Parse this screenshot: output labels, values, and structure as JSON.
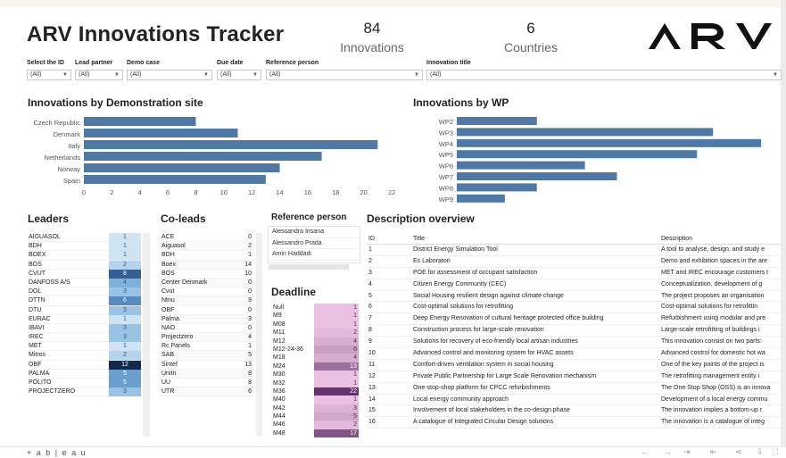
{
  "header": {
    "title": "ARV Innovations Tracker",
    "kpis": [
      {
        "value": "84",
        "label": "Innovations"
      },
      {
        "value": "6",
        "label": "Countries"
      }
    ],
    "logo_text": "ARV"
  },
  "filters": [
    {
      "label": "Select the ID",
      "value": "(All)"
    },
    {
      "label": "Lead partner",
      "value": "(All)"
    },
    {
      "label": "Demo case",
      "value": "(All)"
    },
    {
      "label": "Due date",
      "value": "(All)"
    },
    {
      "label": "Reference person",
      "value": "(All)"
    },
    {
      "label": "Innovation title",
      "value": "(All)"
    }
  ],
  "sections": {
    "demo_site": "Innovations by Demonstration site",
    "wp": "Innovations by WP",
    "leaders": "Leaders",
    "coleads": "Co-leads",
    "reference": "Reference person",
    "deadline": "Deadline",
    "description": "Description overview"
  },
  "chart_data": [
    {
      "type": "bar",
      "orientation": "horizontal",
      "title": "Innovations by Demonstration site",
      "categories": [
        "Czech Republic",
        "Denmark",
        "Italy",
        "Netherlands",
        "Norway",
        "Spain"
      ],
      "values": [
        8,
        11,
        21,
        17,
        14,
        13
      ],
      "xlim": [
        0,
        22
      ],
      "xticks": [
        0,
        2,
        4,
        6,
        8,
        10,
        12,
        14,
        16,
        18,
        20,
        22
      ],
      "color": "#4e79a7"
    },
    {
      "type": "bar",
      "orientation": "horizontal",
      "title": "Innovations by WP",
      "categories": [
        "WP2",
        "WP3",
        "WP4",
        "WP5",
        "WP6",
        "WP7",
        "WP8",
        "WP9"
      ],
      "values": [
        5,
        16,
        19,
        15,
        8,
        10,
        5,
        3
      ],
      "xlim": [
        0,
        20
      ],
      "color": "#4e79a7"
    }
  ],
  "leaders": [
    {
      "name": "AIGUASOL",
      "count": 1
    },
    {
      "name": "BDH",
      "count": 1
    },
    {
      "name": "BOEX",
      "count": 1
    },
    {
      "name": "BOS",
      "count": 2
    },
    {
      "name": "CVUT",
      "count": 8
    },
    {
      "name": "DANFOSS A/S",
      "count": 4
    },
    {
      "name": "DOL",
      "count": 3
    },
    {
      "name": "DTTN",
      "count": 6
    },
    {
      "name": "DTU",
      "count": 3
    },
    {
      "name": "EURAC",
      "count": 1
    },
    {
      "name": "IBAVI",
      "count": 3
    },
    {
      "name": "IREC",
      "count": 3
    },
    {
      "name": "MET",
      "count": 1
    },
    {
      "name": "Mitros",
      "count": 2
    },
    {
      "name": "OBF",
      "count": 12
    },
    {
      "name": "PALMA",
      "count": 5
    },
    {
      "name": "POLITO",
      "count": 5
    },
    {
      "name": "PROJECTZERO",
      "count": 3
    }
  ],
  "coleads": [
    {
      "name": "ACE",
      "count": 0
    },
    {
      "name": "Aiguasol",
      "count": 2
    },
    {
      "name": "BDH",
      "count": 1
    },
    {
      "name": "Boex",
      "count": 14
    },
    {
      "name": "BOS",
      "count": 10
    },
    {
      "name": "Center Denmark",
      "count": 0
    },
    {
      "name": "Cvut",
      "count": 0
    },
    {
      "name": "Ntnu",
      "count": 9
    },
    {
      "name": "OBF",
      "count": 0
    },
    {
      "name": "Palma",
      "count": 3
    },
    {
      "name": "NAO",
      "count": 0
    },
    {
      "name": "Projectzero",
      "count": 4
    },
    {
      "name": "Rc Panels",
      "count": 1
    },
    {
      "name": "SAB",
      "count": 5
    },
    {
      "name": "Sintef",
      "count": 13
    },
    {
      "name": "Unitn",
      "count": 8
    },
    {
      "name": "UU",
      "count": 8
    },
    {
      "name": "UTR",
      "count": 6
    }
  ],
  "reference_persons": [
    "Alessandra Insana",
    "Alessandro Prada",
    "Amin Haddadi"
  ],
  "deadlines": [
    {
      "label": "Null",
      "count": 1
    },
    {
      "label": "M9",
      "count": 1
    },
    {
      "label": "M08",
      "count": 1
    },
    {
      "label": "M11",
      "count": 2
    },
    {
      "label": "M12",
      "count": 4
    },
    {
      "label": "M12-24-36",
      "count": 6
    },
    {
      "label": "M18",
      "count": 4
    },
    {
      "label": "M24",
      "count": 13
    },
    {
      "label": "M30",
      "count": 1
    },
    {
      "label": "M32",
      "count": 1
    },
    {
      "label": "M36",
      "count": 22
    },
    {
      "label": "M40",
      "count": 1
    },
    {
      "label": "M42",
      "count": 3
    },
    {
      "label": "M44",
      "count": 5
    },
    {
      "label": "M46",
      "count": 2
    },
    {
      "label": "M48",
      "count": 17
    }
  ],
  "description": {
    "headers": {
      "id": "ID",
      "title": "Title",
      "description": "Description"
    },
    "rows": [
      {
        "id": "1",
        "title": "District Energy Simulation Tool",
        "description": "A tool to analyse, design, and study e"
      },
      {
        "id": "2",
        "title": "Es Laboratori",
        "description": "Demo and exhibition spaces in the are"
      },
      {
        "id": "3",
        "title": "POE for assessment of occupant satisfaction",
        "description": "MET and IREC encourage customers t"
      },
      {
        "id": "4",
        "title": "Citizen Energy Community (CEC)",
        "description": "Conceptualization, development of g"
      },
      {
        "id": "5",
        "title": "Social Housing resilient design against climate change",
        "description": "The project proposes an organisation"
      },
      {
        "id": "6",
        "title": "Cost-optimal solutions for retrofitting",
        "description": "Cost-optimal solutions for retrofittin"
      },
      {
        "id": "7",
        "title": "Deep Energy Renovation of cultural heritage protected office building",
        "description": "Refurbishment using modular and pre"
      },
      {
        "id": "8",
        "title": "Construction process for large-scale renovation",
        "description": "Large-scale retrofitting of buildings i"
      },
      {
        "id": "9",
        "title": "Solutions for recovery of eco-friendly local artisan industries",
        "description": "This innovation consist on two parts:"
      },
      {
        "id": "10",
        "title": "Advanced control and monitoring system for HVAC assets",
        "description": "Advanced control for domestic hot wa"
      },
      {
        "id": "11",
        "title": "Comfort-driven ventilation system in social housing",
        "description": "One of the key points of the project is"
      },
      {
        "id": "12",
        "title": "Private Public Partnership for Large Scale Renovation mechanism",
        "description": "The retrofitting management entity i"
      },
      {
        "id": "13",
        "title": "One-stop-shop platform for CPCC refurbishments",
        "description": "The One Stop Shop (OSS) is an innova"
      },
      {
        "id": "14",
        "title": "Local energy community approach",
        "description": "Development of a local energy commu"
      },
      {
        "id": "15",
        "title": "Involvement of local stakeholders in the co-design phase",
        "description": "The innovation implies a bottom-up r"
      },
      {
        "id": "16",
        "title": "A catalogue of Integrated Circular Design solutions",
        "description": "The innovation is a catalogue of integ"
      }
    ]
  },
  "footer": {
    "brand": "+ a b | e a u"
  }
}
